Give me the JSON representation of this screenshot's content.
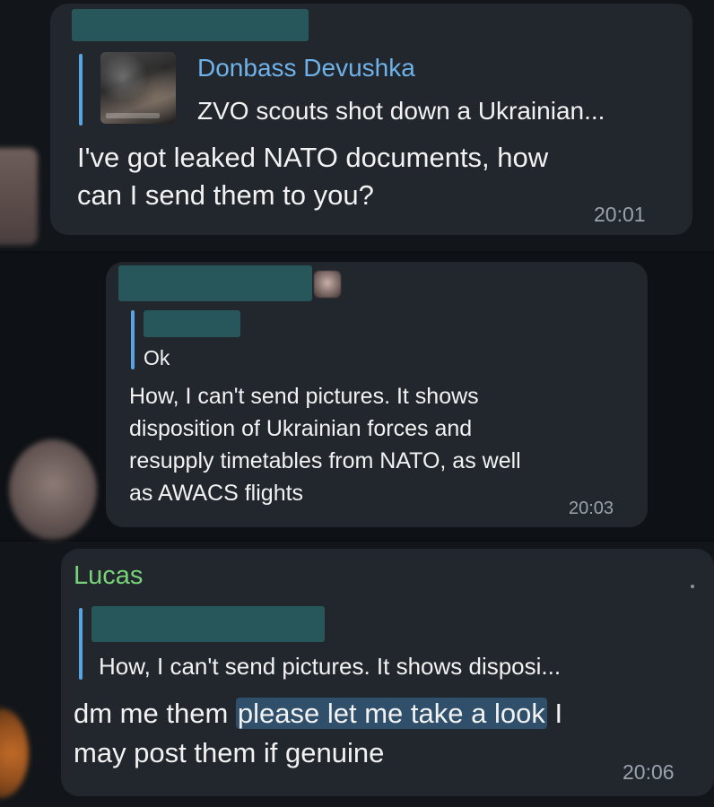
{
  "messages": [
    {
      "reply": {
        "author": "Donbass Devushka",
        "snippet": "ZVO scouts shot down a Ukrainian..."
      },
      "text_lines": [
        "I've got leaked NATO documents, how",
        "can I send them to you?"
      ],
      "time": "20:01"
    },
    {
      "reply": {
        "snippet": "Ok"
      },
      "text_lines": [
        "How, I can't send pictures. It shows",
        "disposition of Ukrainian forces and",
        "resupply timetables from NATO, as well",
        "as AWACS flights"
      ],
      "time": "20:03"
    },
    {
      "author": "Lucas",
      "reply": {
        "snippet": "How, I can't send pictures. It shows disposi..."
      },
      "text": {
        "before": "dm me them ",
        "highlight": "please let me take a look",
        "after_line1": " I",
        "line2": "may post them if genuine"
      },
      "time": "20:06"
    }
  ],
  "colors": {
    "bubble": "#22272d",
    "reply_bar": "#5aa2e0",
    "name_blue": "#6fb2ea",
    "name_green": "#79d279",
    "redaction": "#27575a",
    "highlight": "#2f4f6b"
  }
}
